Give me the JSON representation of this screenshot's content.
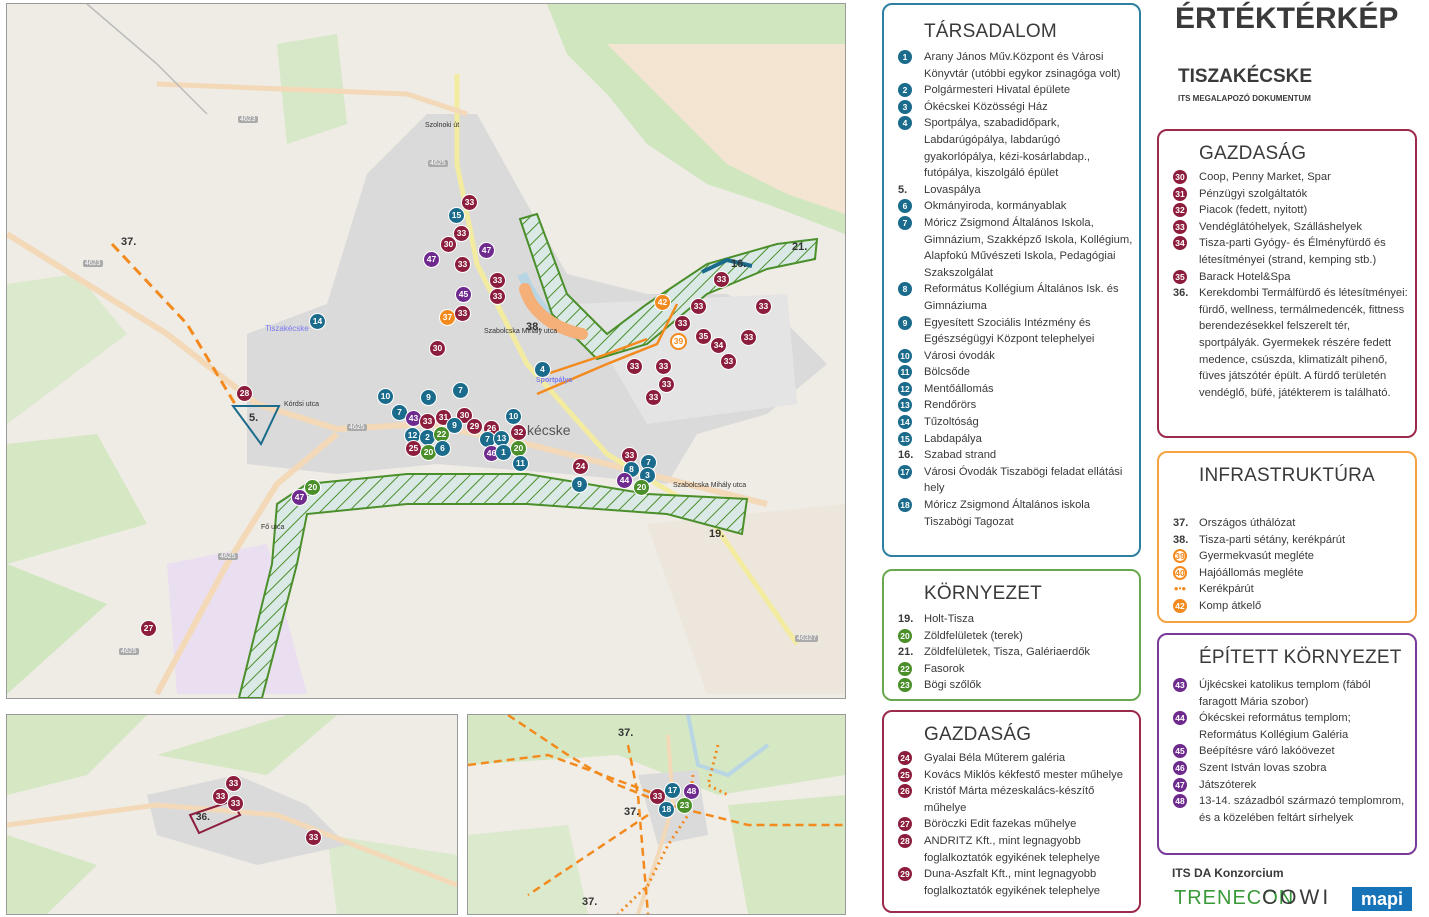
{
  "header": {
    "title": "ÉRTÉKTÉRKÉP",
    "subtitle": "TISZAKÉCSKE",
    "caption": "ITS MEGALAPOZÓ DOKUMENTUM"
  },
  "colors": {
    "tarsadalom": "#1b6b8c",
    "kornyezet": "#4a8f2a",
    "gazdasag": "#8c1d3c",
    "infrastruktura": "#f28a1e",
    "epitett": "#6e2a8c"
  },
  "tarsadalom": {
    "title": "TÁRSADALOM",
    "items": [
      {
        "n": "1",
        "t": "Arany János Műv.Központ és Városi Könyvtár (utóbbi egykor zsinagóga volt)"
      },
      {
        "n": "2",
        "t": "Polgármesteri Hivatal épülete"
      },
      {
        "n": "3",
        "t": "Ókécskei Közösségi Ház"
      },
      {
        "n": "4",
        "t": "Sportpálya, szabadidőpark, Labdarúgópálya, labdarúgó gyakorlópálya, kézi-kosárlabdap., futópálya, kiszolgáló épület"
      },
      {
        "n": "5.",
        "t": "Lovaspálya",
        "plain": true
      },
      {
        "n": "6",
        "t": "Okmányiroda, kormányablak"
      },
      {
        "n": "7",
        "t": "Móricz Zsigmond Általános Iskola, Gimnázium, Szakképző Iskola, Kollégium, Alapfokú Művészeti Iskola, Pedagógiai Szakszolgálat"
      },
      {
        "n": "8",
        "t": "Református Kollégium Általános Isk. és Gimnáziuma"
      },
      {
        "n": "9",
        "t": "Egyesített Szociális Intézmény és Egészségügyi Központ telephelyei"
      },
      {
        "n": "10",
        "t": "Városi óvodák"
      },
      {
        "n": "11",
        "t": "Bölcsőde"
      },
      {
        "n": "12",
        "t": "Mentőállomás"
      },
      {
        "n": "13",
        "t": "Rendőrörs"
      },
      {
        "n": "14",
        "t": "Tűzoltóság"
      },
      {
        "n": "15",
        "t": "Labdapálya"
      },
      {
        "n": "16.",
        "t": "Szabad strand",
        "plain": true
      },
      {
        "n": "17",
        "t": "Városi Óvodák Tiszabögi feladat ellátási hely"
      },
      {
        "n": "18",
        "t": "Móricz Zsigmond Általános iskola Tiszabögi Tagozat"
      }
    ]
  },
  "kornyezet": {
    "title": "KÖRNYEZET",
    "items": [
      {
        "n": "19.",
        "t": "Holt-Tisza",
        "plain": true
      },
      {
        "n": "20",
        "t": "Zöldfelületek (terek)"
      },
      {
        "n": "21.",
        "t": "Zöldfelületek, Tisza, Galériaerdők",
        "plain": true
      },
      {
        "n": "22",
        "t": "Fasorok"
      },
      {
        "n": "23",
        "t": "Bögi szőlők"
      }
    ]
  },
  "gazdasag1": {
    "title": "GAZDASÁG",
    "items": [
      {
        "n": "24",
        "t": "Gyalai Béla Műterem galéria"
      },
      {
        "n": "25",
        "t": "Kovács Miklós kékfestő mester műhelye"
      },
      {
        "n": "26",
        "t": "Kristóf Márta mézeskalács-készítő műhelye"
      },
      {
        "n": "27",
        "t": "Böröczki Edit fazekas műhelye"
      },
      {
        "n": "28",
        "t": "ANDRITZ Kft., mint legnagyobb foglalkoztatók egyikének telephelye"
      },
      {
        "n": "29",
        "t": "Duna-Aszfalt Kft., mint legnagyobb foglalkoztatók egyikének telephelye"
      }
    ]
  },
  "gazdasag2": {
    "title": "GAZDASÁG",
    "items": [
      {
        "n": "30",
        "t": "Coop, Penny Market, Spar"
      },
      {
        "n": "31",
        "t": "Pénzügyi szolgáltatók"
      },
      {
        "n": "32",
        "t": "Piacok (fedett, nyitott)"
      },
      {
        "n": "33",
        "t": "Vendéglátóhelyek, Szálláshelyek"
      },
      {
        "n": "34",
        "t": "Tisza-parti Gyógy- és Élményfürdő és létesítményei (strand, kemping stb.)"
      },
      {
        "n": "35",
        "t": "Barack Hotel&Spa"
      },
      {
        "n": "36.",
        "t": "Kerekdombi Termálfürdő és létesítményei: fürdő, wellness, termálmedencék, fittness berendezésekkel felszerelt tér, sportpályák. Gyermekek részére fedett medence, csúszda, klimatizált pihenő, füves játszótér épült. A fürdő területén vendéglő, büfé, játékterem is található.",
        "plain": true
      }
    ]
  },
  "infrastruktura": {
    "title": "INFRASTRUKTÚRA",
    "items": [
      {
        "n": "37.",
        "t": "Országos úthálózat",
        "plain": true
      },
      {
        "n": "38.",
        "t": "Tisza-parti sétány, kerékpárút",
        "plain": true
      },
      {
        "n": "39",
        "t": "Gyermekvasút megléte",
        "ring": true
      },
      {
        "n": "40",
        "t": "Hajóállomás megléte",
        "ring": true
      },
      {
        "n": "",
        "t": "Kerékpárút",
        "dots": true
      },
      {
        "n": "42",
        "t": "Komp átkelő"
      }
    ]
  },
  "epitett": {
    "title": "ÉPÍTETT KÖRNYEZET",
    "items": [
      {
        "n": "43",
        "t": "Újkécskei katolikus templom (fából faragott Mária szobor)"
      },
      {
        "n": "44",
        "t": "Ókécskei református templom; Református Kollégium Galéria"
      },
      {
        "n": "45",
        "t": "Beépítésre váró lakóövezet"
      },
      {
        "n": "46",
        "t": "Szent István lovas szobra"
      },
      {
        "n": "47",
        "t": "Játszóterek"
      },
      {
        "n": "48",
        "t": "13-14. századból származó templomrom, és a közelében feltárt sírhelyek"
      }
    ]
  },
  "footer": {
    "consortium": "ITS DA Konzorcium",
    "logo1": "TRENECON",
    "logo2": "COWI",
    "logo3": "mapi"
  },
  "map_labels": {
    "town": "Tiszakécske",
    "town_short": "kécske",
    "lbl37": "37.",
    "lbl38": "38.",
    "lbl5": "5.",
    "lbl16": "16.",
    "lbl19": "19.",
    "lbl21": "21.",
    "lbl36": "36.",
    "sportpalya": "Sportpálya",
    "kordi": "Kórdsi utca",
    "fo": "Fő utca",
    "szolnoki": "Szolnoki út",
    "szabolcska": "Szabolcska Mihály utca",
    "szabolcska2": "Szabolcska Mihály utca",
    "r4623": "4623",
    "r4623b": "4623",
    "r4625": "4625",
    "r4625b": "4625",
    "r4625c": "4625",
    "r4625d": "4625",
    "r46327": "46327"
  }
}
